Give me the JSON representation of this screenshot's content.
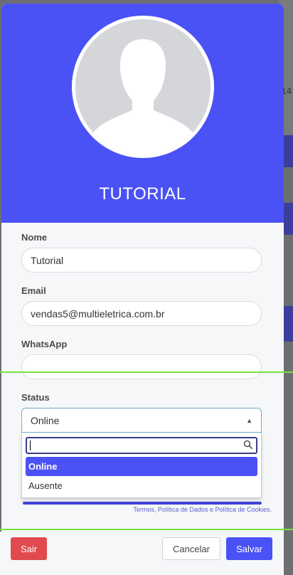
{
  "background": {
    "partial_number": "14"
  },
  "profile": {
    "title": "TUTORIAL",
    "avatar_icon": "person-silhouette-icon"
  },
  "form": {
    "nome_label": "Nome",
    "nome_value": "Tutorial",
    "email_label": "Email",
    "email_value": "vendas5@multieletrica.com.br",
    "whatsapp_label": "WhatsApp",
    "whatsapp_value": "",
    "status_label": "Status",
    "status_value": "Online"
  },
  "status_dropdown": {
    "search_value": "",
    "options": [
      "Online",
      "Ausente"
    ],
    "selected": "Online"
  },
  "terms_text": "Termos, Política de Dados e Política de Cookies.",
  "footer": {
    "logout_label": "Sair",
    "cancel_label": "Cancelar",
    "save_label": "Salvar"
  },
  "colors": {
    "primary": "#4a52f5",
    "danger": "#e14a4e",
    "highlight_line": "#78e23c"
  }
}
